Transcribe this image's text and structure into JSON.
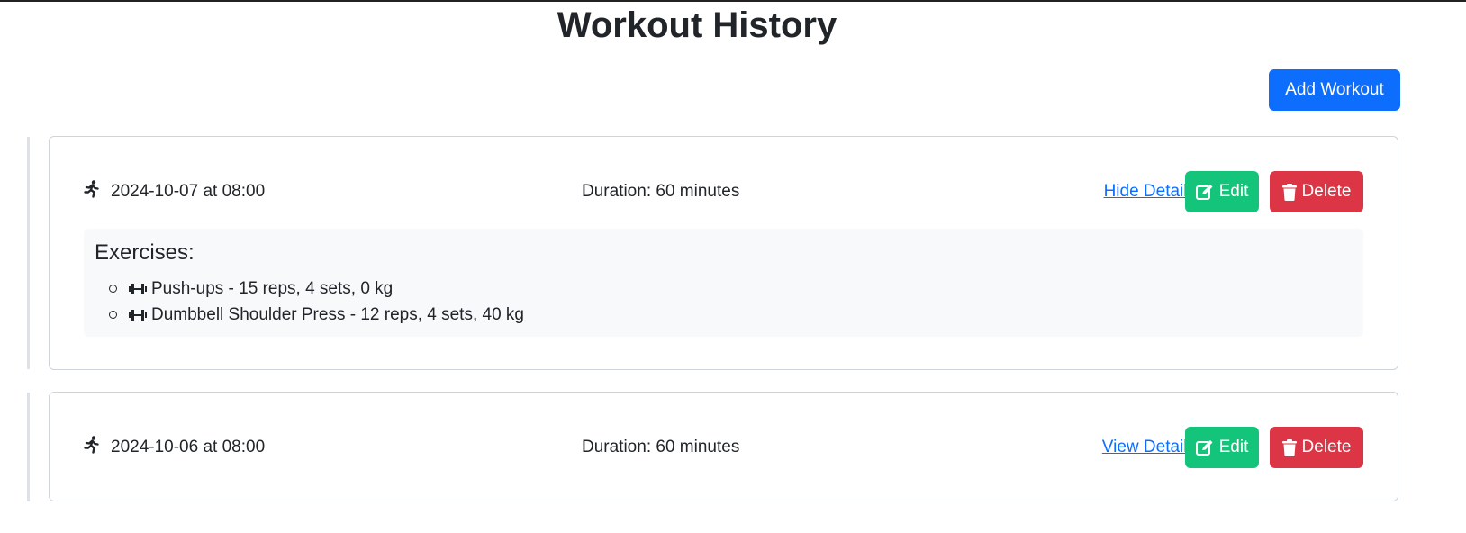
{
  "header": {
    "title": "Workout History",
    "add_label": "Add Workout"
  },
  "workouts": [
    {
      "date": "2024-10-07 at 08:00",
      "duration": "Duration: 60 minutes",
      "details_label": "Hide Details",
      "edit_label": "Edit",
      "delete_label": "Delete",
      "expanded": true,
      "exercises_heading": "Exercises:",
      "exercises": [
        "Push-ups - 15 reps, 4 sets, 0 kg",
        "Dumbbell Shoulder Press - 12 reps, 4 sets, 40 kg"
      ]
    },
    {
      "date": "2024-10-06 at 08:00",
      "duration": "Duration: 60 minutes",
      "details_label": "View Details",
      "edit_label": "Edit",
      "delete_label": "Delete",
      "expanded": false
    }
  ],
  "icons": {
    "workout": "running-icon",
    "exercise": "dumbbell-icon",
    "edit": "edit-icon",
    "delete": "trash-icon"
  },
  "colors": {
    "primary": "#0d6efd",
    "edit": "#14c47a",
    "delete": "#dc3545",
    "panel": "#f8f9fa"
  }
}
